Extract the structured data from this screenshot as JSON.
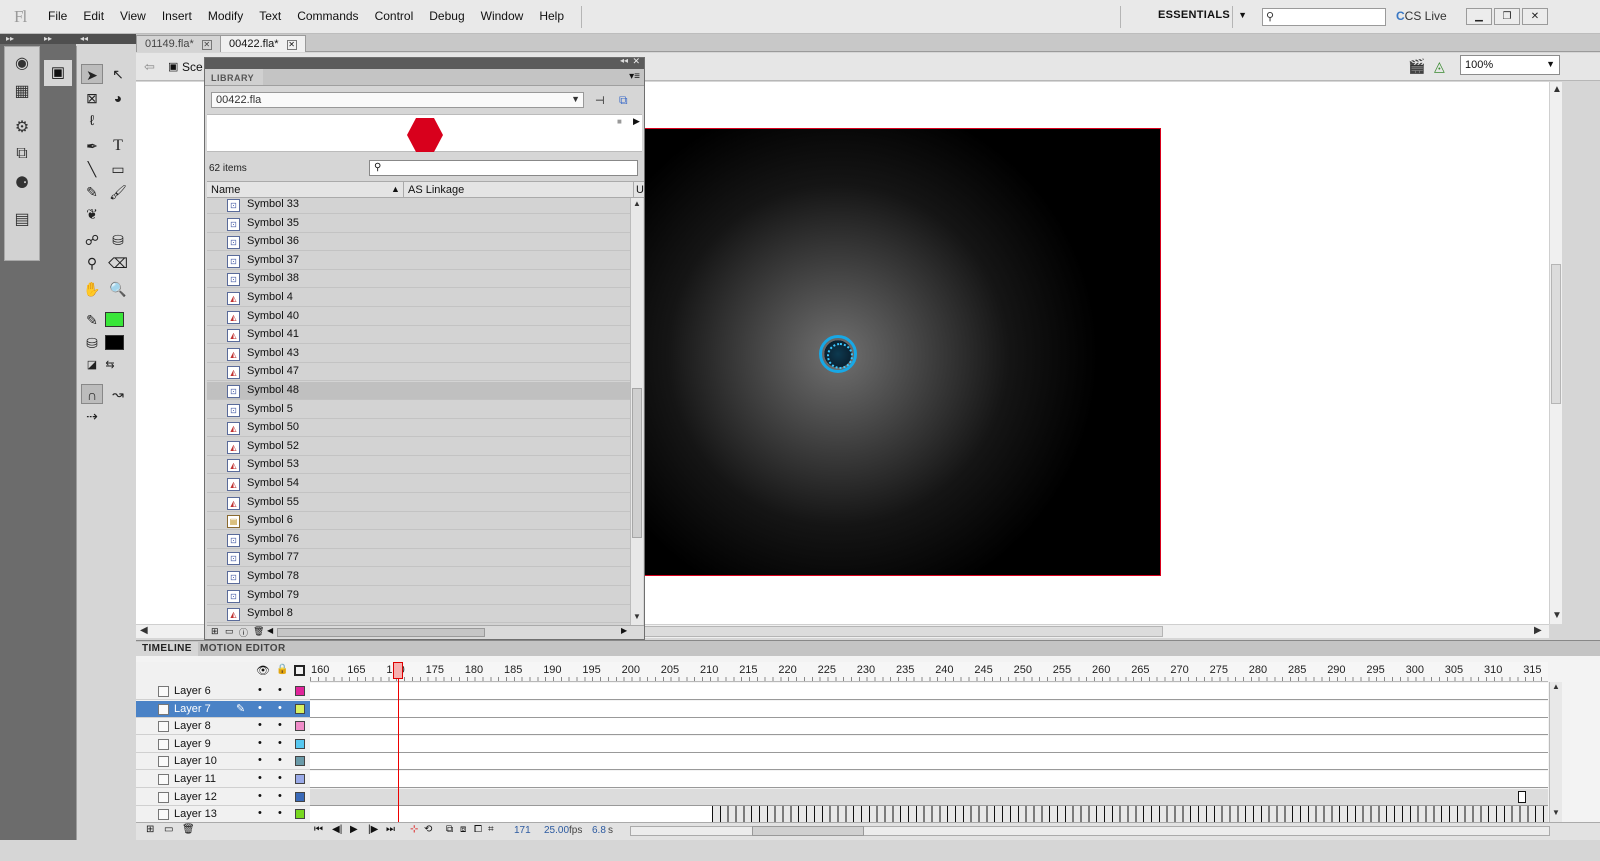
{
  "app": {
    "logo": "Fl"
  },
  "menu": [
    "File",
    "Edit",
    "View",
    "Insert",
    "Modify",
    "Text",
    "Commands",
    "Control",
    "Debug",
    "Window",
    "Help"
  ],
  "workspace": {
    "label": "ESSENTIALS"
  },
  "cslive": {
    "label": "CS Live"
  },
  "doc_tabs": [
    {
      "label": "01149.fla*"
    },
    {
      "label": "00422.fla*"
    }
  ],
  "editbar": {
    "scene": "Sce",
    "zoom": "100%"
  },
  "library": {
    "title": "LIBRARY",
    "file": "00422.fla",
    "count": "62 items",
    "col_name": "Name",
    "col_linkage": "AS Linkage",
    "col_u": "U",
    "items": [
      {
        "name": "Symbol 33",
        "kind": "btn"
      },
      {
        "name": "Symbol 35",
        "kind": "btn"
      },
      {
        "name": "Symbol 36",
        "kind": "btn"
      },
      {
        "name": "Symbol 37",
        "kind": "btn"
      },
      {
        "name": "Symbol 38",
        "kind": "btn"
      },
      {
        "name": "Symbol 4",
        "kind": "gfx"
      },
      {
        "name": "Symbol 40",
        "kind": "gfx"
      },
      {
        "name": "Symbol 41",
        "kind": "gfx"
      },
      {
        "name": "Symbol 43",
        "kind": "gfx"
      },
      {
        "name": "Symbol 47",
        "kind": "gfx"
      },
      {
        "name": "Symbol 48",
        "kind": "btn",
        "selected": true
      },
      {
        "name": "Symbol 5",
        "kind": "btn"
      },
      {
        "name": "Symbol 50",
        "kind": "gfx"
      },
      {
        "name": "Symbol 52",
        "kind": "gfx"
      },
      {
        "name": "Symbol 53",
        "kind": "gfx"
      },
      {
        "name": "Symbol 54",
        "kind": "gfx"
      },
      {
        "name": "Symbol 55",
        "kind": "gfx"
      },
      {
        "name": "Symbol 6",
        "kind": "clip"
      },
      {
        "name": "Symbol 76",
        "kind": "btn"
      },
      {
        "name": "Symbol 77",
        "kind": "btn"
      },
      {
        "name": "Symbol 78",
        "kind": "btn"
      },
      {
        "name": "Symbol 79",
        "kind": "btn"
      },
      {
        "name": "Symbol 8",
        "kind": "gfx"
      }
    ]
  },
  "timeline": {
    "tabs": [
      "TIMELINE",
      "MOTION EDITOR"
    ],
    "ruler": [
      "160",
      "165",
      "170",
      "175",
      "180",
      "185",
      "190",
      "195",
      "200",
      "205",
      "210",
      "215",
      "220",
      "225",
      "230",
      "235",
      "240",
      "245",
      "250",
      "255",
      "260",
      "265",
      "270",
      "275",
      "280",
      "285",
      "290",
      "295",
      "300",
      "305",
      "310",
      "315"
    ],
    "layers": [
      {
        "name": "Layer 6",
        "color": "#e0249a"
      },
      {
        "name": "Layer 7",
        "color": "#d8f060",
        "selected": true
      },
      {
        "name": "Layer 8",
        "color": "#f08cc8"
      },
      {
        "name": "Layer 9",
        "color": "#58c8f0"
      },
      {
        "name": "Layer 10",
        "color": "#6a9aa8"
      },
      {
        "name": "Layer 11",
        "color": "#9aaae8"
      },
      {
        "name": "Layer 12",
        "color": "#3a6ab8"
      },
      {
        "name": "Layer 13",
        "color": "#78d820"
      }
    ],
    "current_frame": "171",
    "fps": "25.00",
    "fps_unit": "fps",
    "elapsed": "6.8",
    "elapsed_unit": "s"
  },
  "colors": {
    "stroke": "#39e639",
    "fill": "#000000",
    "stage_border": "#d8001c"
  }
}
